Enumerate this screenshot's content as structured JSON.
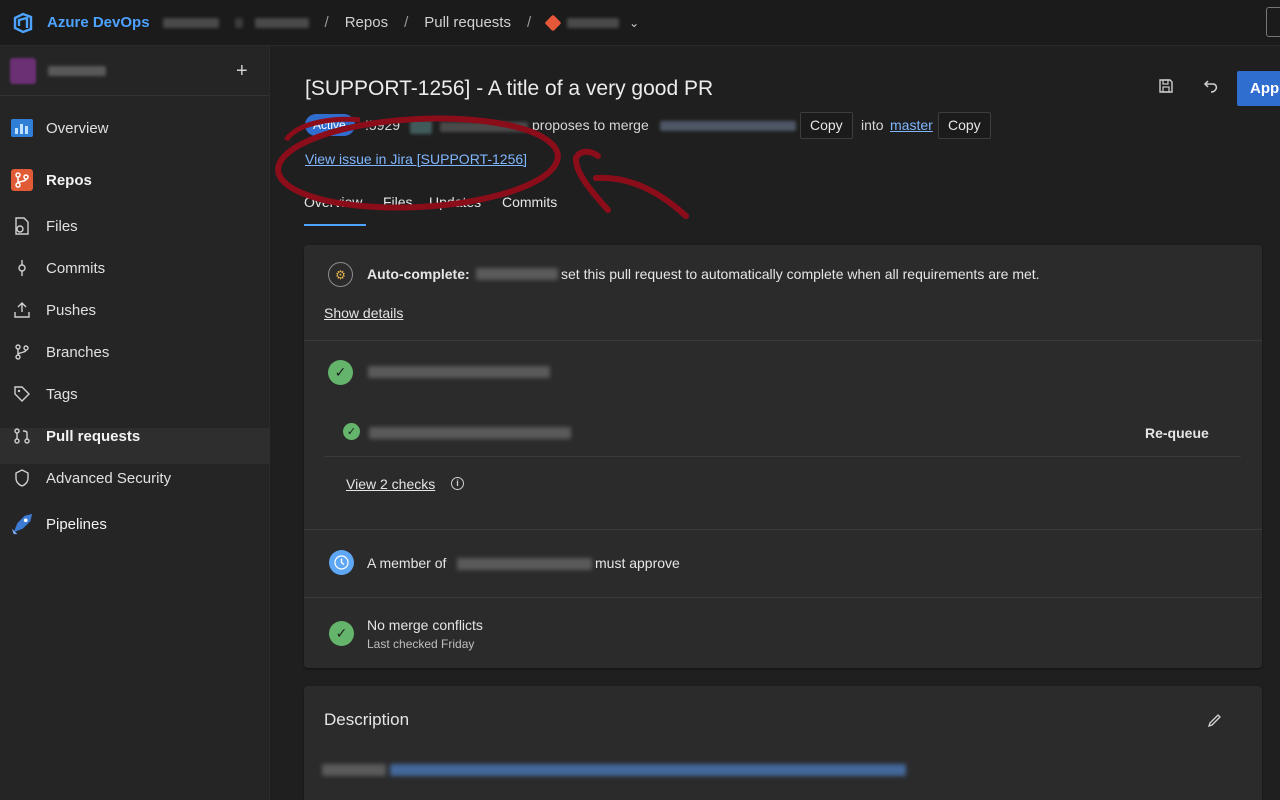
{
  "topbar": {
    "brand": "Azure DevOps",
    "crumbs": [
      "Repos",
      "Pull requests"
    ]
  },
  "sidebar": {
    "add_label": "+",
    "items": [
      {
        "label": "Overview",
        "icon": "overview-icon"
      },
      {
        "label": "Repos",
        "icon": "repos-icon"
      },
      {
        "label": "Files",
        "icon": "files-icon"
      },
      {
        "label": "Commits",
        "icon": "commits-icon"
      },
      {
        "label": "Pushes",
        "icon": "pushes-icon"
      },
      {
        "label": "Branches",
        "icon": "branches-icon"
      },
      {
        "label": "Tags",
        "icon": "tags-icon"
      },
      {
        "label": "Pull requests",
        "icon": "pull-requests-icon"
      },
      {
        "label": "Advanced Security",
        "icon": "shield-icon"
      },
      {
        "label": "Pipelines",
        "icon": "pipelines-icon"
      }
    ]
  },
  "pr": {
    "title": "[SUPPORT-1256] - A title of a very good PR",
    "status": "Active",
    "id": "!5929",
    "proposes": "proposes to merge",
    "copy": "Copy",
    "into": "into",
    "target_branch": "master",
    "jira_link": "View issue in Jira [SUPPORT-1256]",
    "approve": "Approve"
  },
  "tabs": [
    "Overview",
    "Files",
    "Updates",
    "Commits"
  ],
  "status_card": {
    "autocomplete_label": "Auto-complete:",
    "autocomplete_text": "set this pull request to automatically complete when all requirements are met.",
    "show_details": "Show details",
    "requeue": "Re-queue",
    "view_checks": "View 2 checks",
    "approver_prefix": "A member of",
    "approver_suffix": "must approve",
    "no_conflicts": "No merge conflicts",
    "last_checked": "Last checked Friday"
  },
  "description": {
    "title": "Description"
  },
  "colors": {
    "accent": "#2f6ecf",
    "success": "#64b46b",
    "link": "#7fb6ff",
    "annotation": "#8b0d1a"
  }
}
